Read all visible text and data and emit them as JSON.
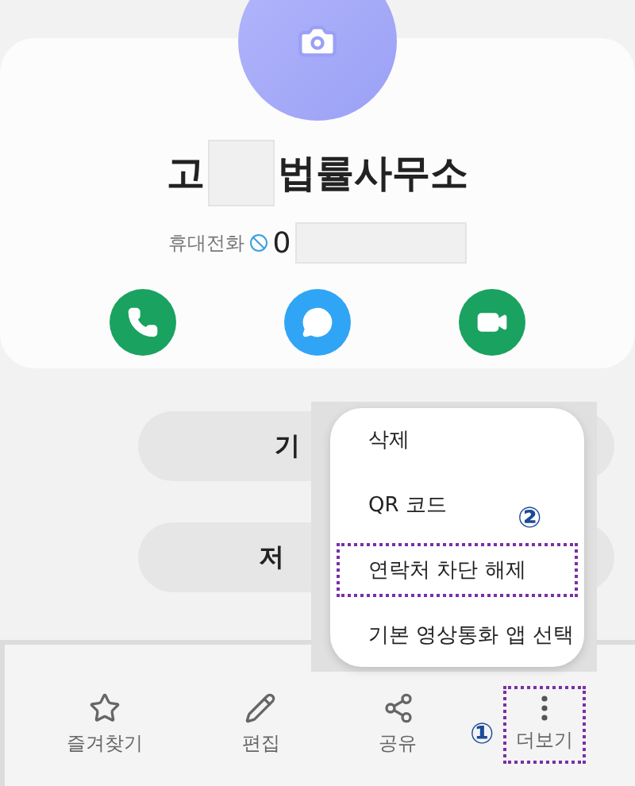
{
  "contact": {
    "name_start": "고",
    "name_end": "법률사무소",
    "phone_label": "휴대전화",
    "phone_start": "0"
  },
  "actions": [
    {
      "kind": "call",
      "color": "#1aa260"
    },
    {
      "kind": "message",
      "color": "#31a5f5"
    },
    {
      "kind": "video",
      "color": "#1aa260"
    }
  ],
  "pills": [
    "기",
    "저"
  ],
  "menu": {
    "items": [
      {
        "label": "삭제",
        "highlighted": false
      },
      {
        "label": "QR 코드",
        "highlighted": false
      },
      {
        "label": "연락처 차단 해제",
        "highlighted": true,
        "marker": "②"
      },
      {
        "label": "기본 영상통화 앱 선택",
        "highlighted": false
      }
    ]
  },
  "bottom_bar": [
    {
      "kind": "star",
      "label": "즐겨찾기",
      "highlighted": false
    },
    {
      "kind": "edit",
      "label": "편집",
      "highlighted": false
    },
    {
      "kind": "share",
      "label": "공유",
      "highlighted": false
    },
    {
      "kind": "more",
      "label": "더보기",
      "highlighted": true,
      "marker": "①"
    }
  ]
}
